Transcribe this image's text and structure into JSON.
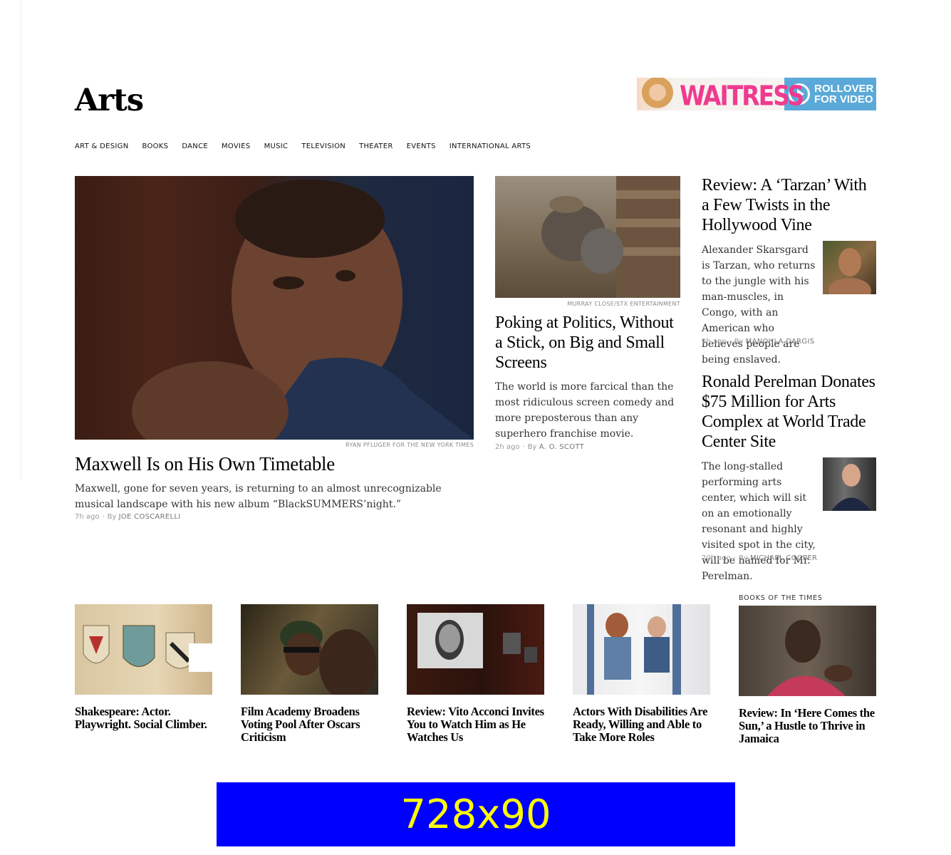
{
  "section": {
    "title": "Arts"
  },
  "top_ad": {
    "title": "WAITRESS",
    "cta_line1": "ROLLOVER",
    "cta_line2": "FOR VIDEO",
    "accent": "#ef3b8f",
    "panel": "#5aa9d8"
  },
  "nav": {
    "items": [
      "Art & Design",
      "Books",
      "Dance",
      "Movies",
      "Music",
      "Television",
      "Theater",
      "Events",
      "International Arts"
    ]
  },
  "lead": {
    "credit": "RYAN PFLUGER FOR THE NEW YORK TIMES",
    "headline": "Maxwell Is on His Own Timetable",
    "summary": "Maxwell, gone for seven years, is returning to an almost unrecognizable musical landscape with his new album “BlackSUMMERS’night.”",
    "time": "7h ago",
    "by": "By",
    "author": "JOE COSCARELLI"
  },
  "second": {
    "credit": "MURRAY CLOSE/STX ENTERTAINMENT",
    "headline": "Poking at Politics, Without a Stick, on Big and Small Screens",
    "summary": "The world is more farcical than the most ridiculous screen comedy and more preposterous than any superhero franchise movie.",
    "time": "2h ago",
    "by": "By",
    "author": "A. O. SCOTT"
  },
  "right1": {
    "headline": "Review: A ‘Tarzan’ With a Few Twists in the Hollywood Vine",
    "summary": "Alexander Skarsgard is Tarzan, who returns to the jungle with his man-muscles, in Congo, with an American who believes people are being enslaved.",
    "time": "2h ago",
    "by": "By",
    "author": "MANOHLA DARGIS"
  },
  "right2": {
    "headline": "Ronald Perelman Donates $75 Million for Arts Complex at World Trade Center Site",
    "summary": "The long-stalled performing arts center, which will sit on an emotionally resonant and highly visited spot in the city, will be named for Mr. Perelman.",
    "time": "20h ago",
    "by": "By",
    "author": "MICHAEL COOPER"
  },
  "strip": [
    {
      "kicker": "",
      "headline": "Shakespeare: Actor. Playwright. Social Climber."
    },
    {
      "kicker": "",
      "headline": "Film Academy Broadens Voting Pool After Oscars Criticism"
    },
    {
      "kicker": "",
      "headline": "Review: Vito Acconci Invites You to Watch Him as He Watches Us"
    },
    {
      "kicker": "",
      "headline": "Actors With Disabilities Are Ready, Willing and Able to Take More Roles"
    },
    {
      "kicker": "BOOKS OF THE TIMES",
      "headline": "Review: In ‘Here Comes the Sun,’ a Hustle to Thrive in Jamaica"
    }
  ],
  "bottom_ad": {
    "label": "728x90",
    "bg": "#0000ff",
    "fg": "#ffff00"
  }
}
